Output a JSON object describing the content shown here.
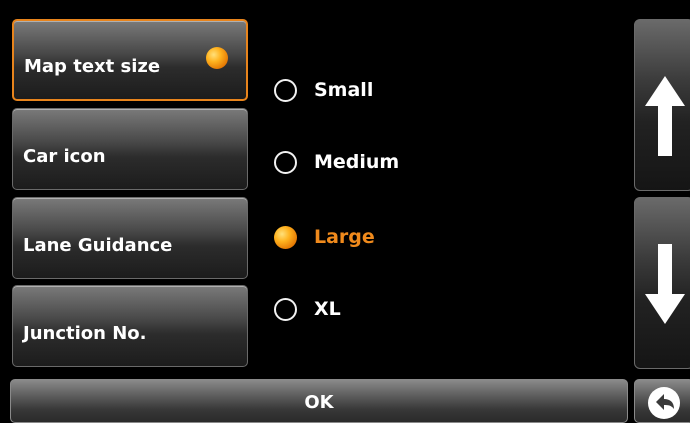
{
  "menu": {
    "items": [
      {
        "label": "Map text size",
        "active": true
      },
      {
        "label": "Car icon",
        "active": false
      },
      {
        "label": "Lane Guidance",
        "active": false
      },
      {
        "label": "Junction No.",
        "active": false
      }
    ]
  },
  "options": {
    "items": [
      {
        "label": "Small",
        "selected": false
      },
      {
        "label": "Medium",
        "selected": false
      },
      {
        "label": "Large",
        "selected": true
      },
      {
        "label": "XL",
        "selected": false
      }
    ]
  },
  "scroll": {
    "up_icon": "arrow-up-icon",
    "down_icon": "arrow-down-icon"
  },
  "footer": {
    "ok_label": "OK",
    "back_icon": "back-arrow-icon"
  },
  "colors": {
    "accent": "#f08a1c",
    "background": "#000000"
  }
}
